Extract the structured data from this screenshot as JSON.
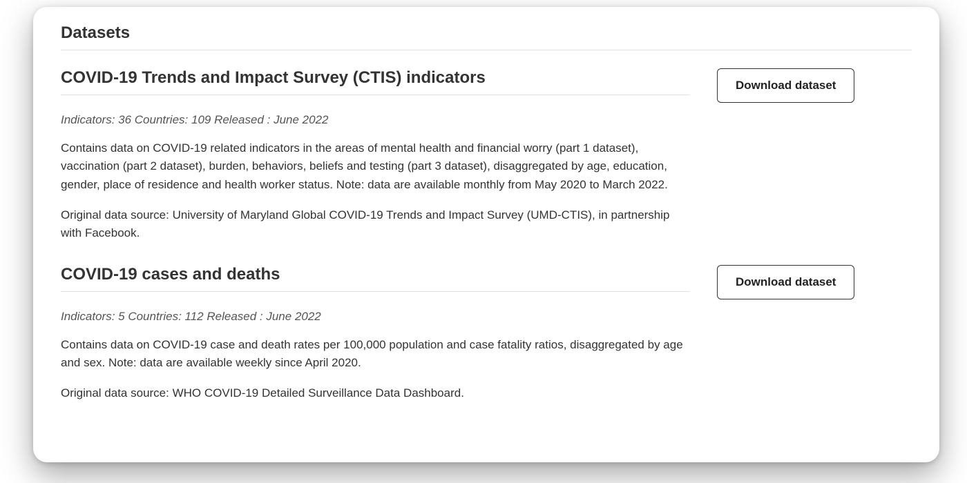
{
  "section": {
    "title": "Datasets"
  },
  "datasets": [
    {
      "title": "COVID-19 Trends and Impact Survey (CTIS) indicators",
      "meta": "Indicators: 36  Countries: 109  Released : June 2022",
      "description": "Contains data on COVID-19 related indicators in the areas of mental health and financial worry (part 1 dataset), vaccination (part 2 dataset), burden, behaviors, beliefs and testing (part 3 dataset), disaggregated by age, education, gender, place of residence and health worker status. Note: data are available monthly from May 2020 to March 2022.",
      "source": "Original data source: University of Maryland Global COVID-19 Trends and Impact Survey (UMD-CTIS), in partnership with Facebook.",
      "button_label": "Download dataset"
    },
    {
      "title": "COVID-19 cases and deaths",
      "meta": "Indicators: 5  Countries: 112  Released : June 2022",
      "description": "Contains data on COVID-19 case and death rates per 100,000 population and case fatality ratios, disaggregated by age and sex. Note: data are available weekly since April 2020.",
      "source": "Original data source: WHO COVID-19 Detailed Surveillance Data Dashboard.",
      "button_label": "Download dataset"
    }
  ]
}
